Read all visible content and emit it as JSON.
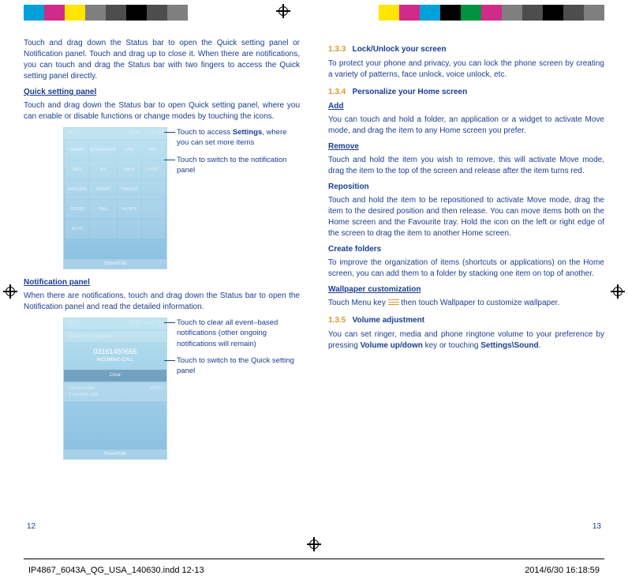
{
  "registration": {
    "time": "18:11",
    "date": "THU, MAY 15"
  },
  "left": {
    "intro": "Touch and drag down the Status bar to open the Quick setting panel or Notification panel. Touch and drag up to close it. When there are notifications, you can touch and drag the Status bar with two fingers to access the Quick setting panel directly.",
    "quick_heading": "Quick setting panel",
    "quick_body": "Touch and drag down the Status bar to open Quick setting panel, where you can enable or disable functions or change modes by touching the icons.",
    "quick_callout1_a": "Touch to access ",
    "quick_callout1_b": "Settings",
    "quick_callout1_c": ", where you can set more items",
    "quick_callout2": "Touch to switch to the notification panel",
    "notif_heading": "Notification panel",
    "notif_body": "When there are notifications, touch and drag down the Status bar to open the Notification panel and read the detailed information.",
    "notif_callout1": "Touch to clear all event–based notifications (other ongoing notifications will remain)",
    "notif_callout2": "Touch to switch to the Quick setting panel",
    "mock_quick_tiles": [
      "OWNER",
      "SCREENSHOT",
      "LINK CONNECTIVITY",
      "SET",
      "WIFI",
      "BLUETOOTH",
      "DATA",
      "AUTOSYNC",
      "AIRPLANE MODE",
      "BRIGHTNESS",
      "TIMEOUT",
      "",
      "SOUND",
      "DIRECT CALL",
      "AUTO ROTATE",
      "",
      "AUTO ON"
    ],
    "mock_notif": {
      "screenshot": "Screenshot captured",
      "number": "03161450666",
      "call": "INCOMING CALL",
      "clear": "Clear",
      "missed": "Missed calls\n3 missed calls",
      "time": "19:00"
    },
    "pagenum": "12"
  },
  "right": {
    "s133_num": "1.3.3",
    "s133_title": "Lock/Unlock your screen",
    "s133_body": "To protect your phone and privacy, you can lock the phone screen by creating a variety of patterns, face unlock, voice unlock, etc.",
    "s134_num": "1.3.4",
    "s134_title": "Personalize your Home screen",
    "add_h": "Add",
    "add_b": "You can touch and hold a folder, an application or a widget to activate Move mode, and drag the item to any Home screen you prefer.",
    "remove_h": "Remove",
    "remove_b": "Touch and hold the item you wish to remove, this will activate Move mode, drag the item to the top of the screen and release after the item turns red.",
    "repo_h": "Reposition",
    "repo_b": "Touch and hold the item to be repositioned to activate  Move mode, drag the item to the desired position and then release. You can move items both on the Home screen and the Favourite tray. Hold the icon on the left or right edge of the screen to drag the item to another Home screen.",
    "fold_h": "Create folders",
    "fold_b": "To improve the organization of items (shortcuts or applications) on the Home screen, you can add them to a folder by stacking one item on top of another.",
    "wall_h": "Wallpaper customization",
    "wall_b_a": "Touch Menu key ",
    "wall_b_b": " then touch Wallpaper to customize wallpaper.",
    "s135_num": "1.3.5",
    "s135_title": "Volume adjustment",
    "s135_body_a": "You can set ringer, media and phone ringtone volume to your preference by pressing ",
    "s135_body_b": "Volume up/down",
    "s135_body_c": " key or touching ",
    "s135_body_d": "Settings\\Sound",
    "s135_body_e": ".",
    "pagenum": "13"
  },
  "footer": {
    "indd": "IP4867_6043A_QG_USA_140630.indd   12-13",
    "ts": "2014/6/30   16:18:59"
  },
  "colors": [
    "#00a0d8",
    "#d12b8a",
    "#ffe500",
    "#7f7f7f",
    "#000000",
    "#7f7f7f",
    "#7f7f7f",
    "#ffffff",
    "#ffffff",
    "#ffffff",
    "#ffffff",
    "#ffe500",
    "#d12b8a",
    "#00a0d8",
    "#00923f",
    "#d12b8a",
    "#7f7f7f",
    "#000000",
    "#7f7f7f"
  ]
}
